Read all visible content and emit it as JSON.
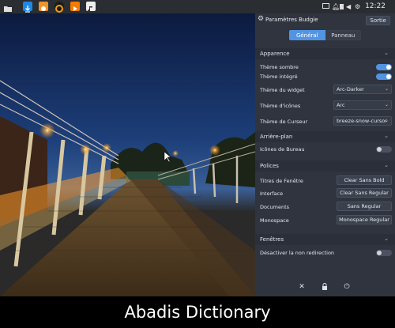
{
  "top_panel": {
    "launchers": [
      {
        "name": "folder-icon",
        "color": "#1e88e5"
      },
      {
        "name": "download-icon",
        "color": "#f39c12"
      },
      {
        "name": "app-icon",
        "color": "#e65100"
      },
      {
        "name": "media-player-icon",
        "color": "#f57c00"
      },
      {
        "name": "music-icon",
        "color": "#e0e0e0"
      }
    ],
    "clock": "12:22"
  },
  "panel": {
    "title": "Paramètres Budgie",
    "exit_label": "Sortie",
    "tabs": [
      {
        "label": "Général",
        "active": true
      },
      {
        "label": "Panneau",
        "active": false
      }
    ],
    "sections": {
      "appearance": {
        "title": "Apparence",
        "rows": [
          {
            "label": "Thème sombre",
            "type": "toggle",
            "on": true
          },
          {
            "label": "Thème intégré",
            "type": "toggle",
            "on": true
          },
          {
            "label": "Thème du widget",
            "type": "combo",
            "value": "Arc-Darker"
          },
          {
            "label": "Thème d'icônes",
            "type": "combo",
            "value": "Arc"
          },
          {
            "label": "Thème de Curseur",
            "type": "combo",
            "value": "breeze-snow-cursor"
          }
        ]
      },
      "background": {
        "title": "Arrière-plan",
        "rows": [
          {
            "label": "Icônes de Bureau",
            "type": "toggle",
            "on": false
          }
        ]
      },
      "fonts": {
        "title": "Polices",
        "rows": [
          {
            "label": "Titres de Fenêtre",
            "value": "Clear Sans Bold"
          },
          {
            "label": "Interface",
            "value": "Clear Sans Regular"
          },
          {
            "label": "Documents",
            "value": "Sans Regular"
          },
          {
            "label": "Monospace",
            "value": "Monospace Regular"
          }
        ]
      },
      "windows": {
        "title": "Fenêtres",
        "rows": [
          {
            "label": "Désactiver la non redirection",
            "type": "toggle",
            "on": false
          }
        ]
      }
    },
    "footer_icons": [
      "tools-icon",
      "lock-icon",
      "power-icon"
    ]
  },
  "caption": "Abadis Dictionary",
  "colors": {
    "accent": "#5294e2",
    "panel_bg": "#2f343f"
  }
}
